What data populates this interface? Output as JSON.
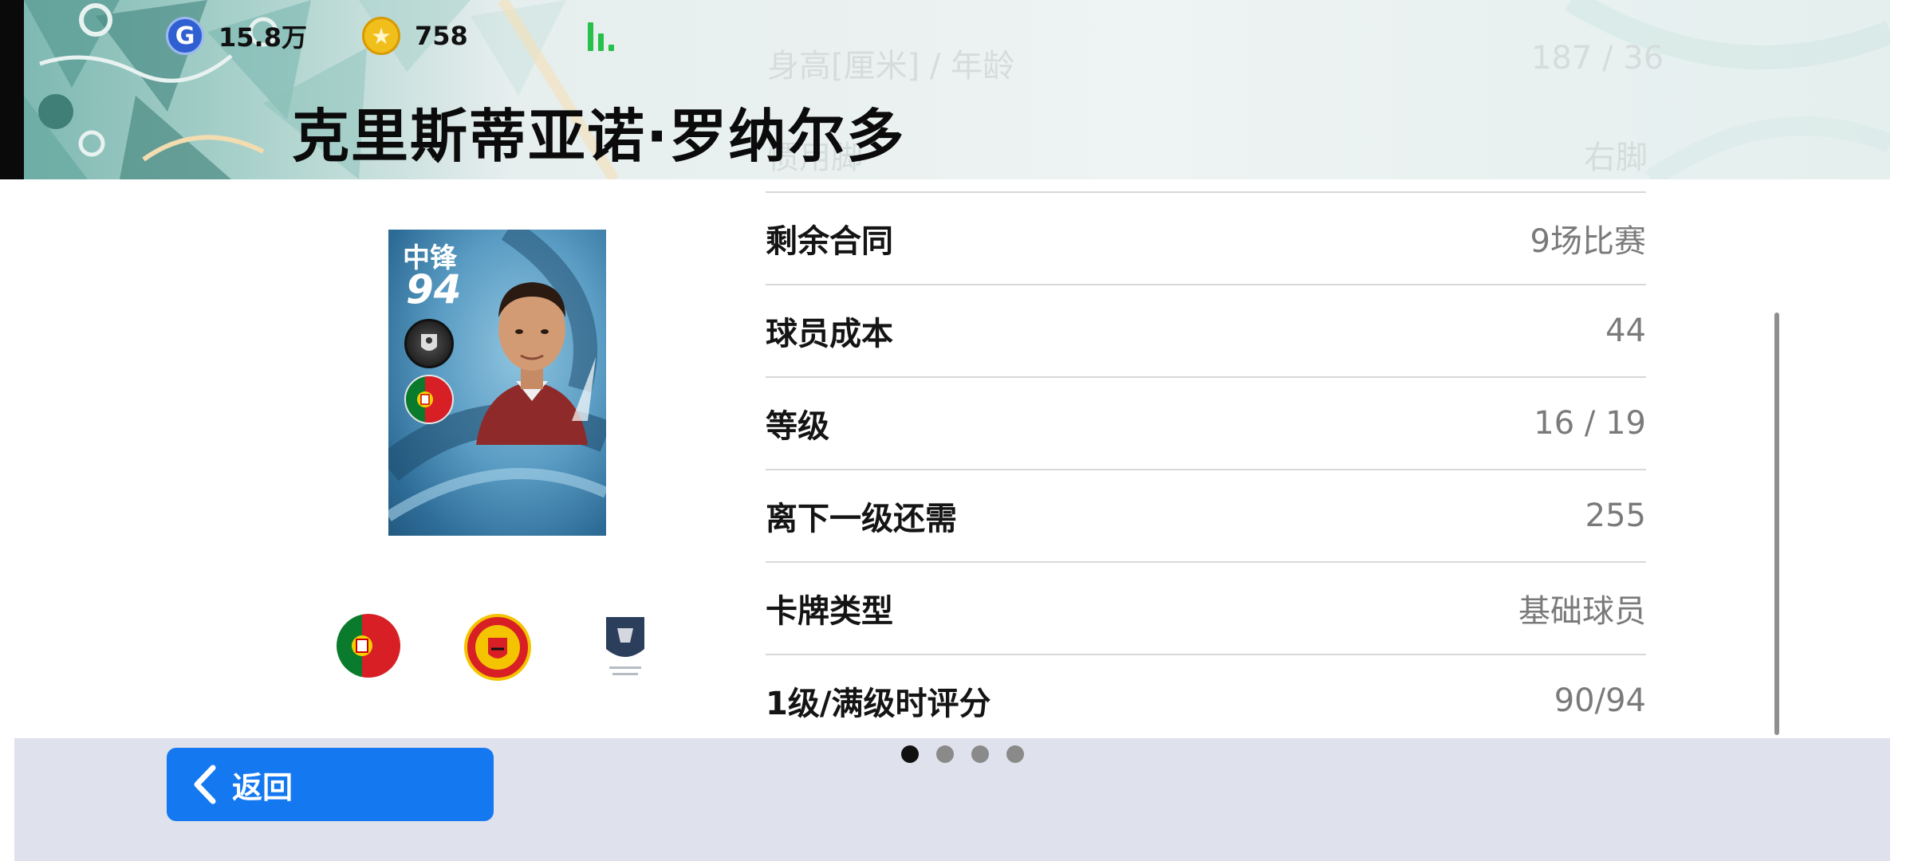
{
  "header": {
    "gp_amount": "15.8万",
    "coin_amount": "758",
    "player_name": "克里斯蒂亚诺·罗纳尔多",
    "ghost_rows": [
      {
        "label": "身高[厘米] / 年龄",
        "value": "187 / 36"
      },
      {
        "label": "惯用脚",
        "value": "右脚"
      }
    ]
  },
  "card": {
    "position": "中锋",
    "overall": "94"
  },
  "stats": [
    {
      "label": "剩余合同",
      "value": "9场比赛"
    },
    {
      "label": "球员成本",
      "value": "44"
    },
    {
      "label": "等级",
      "value": "16 / 19"
    },
    {
      "label": "离下一级还需",
      "value": "255"
    },
    {
      "label": "卡牌类型",
      "value": "基础球员"
    },
    {
      "label": "1级/满级时评分",
      "value": "90/94"
    }
  ],
  "footer": {
    "back_label": "返回",
    "page_count": 4,
    "active_page": 1
  },
  "colors": {
    "accent_blue": "#1479f0",
    "signal_green": "#27c04a",
    "gp_blue": "#2f5fd0",
    "coin_gold": "#f0bf1b"
  }
}
